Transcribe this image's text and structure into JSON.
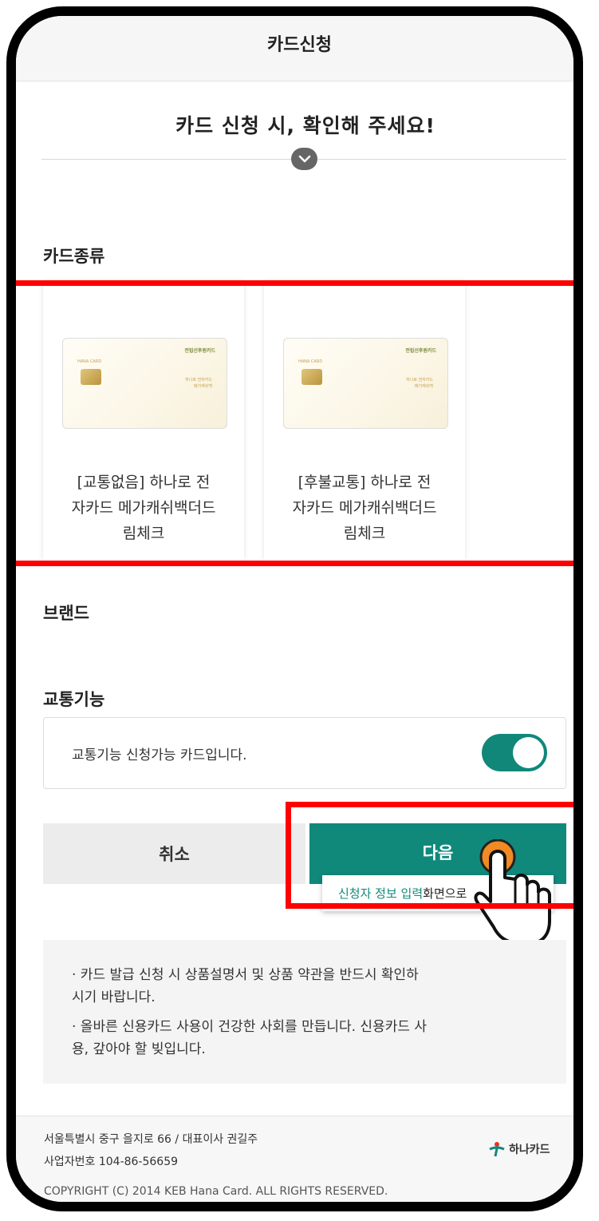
{
  "header": {
    "title": "카드신청"
  },
  "notice": {
    "title": "카드 신청 시, 확인해 주세요!"
  },
  "sections": {
    "card_type": "카드종류",
    "brand": "브랜드",
    "transport": "교통기능"
  },
  "cards": [
    {
      "name": "[교통없음] 하나로 전자카드 메가캐쉬백더드림체크",
      "name_lines": [
        "[교통없음] 하나로 전",
        "자카드 메가캐쉬백더드",
        "림체크"
      ]
    },
    {
      "name": "[후불교통] 하나로 전자카드 메가캐쉬백더드림체크",
      "name_lines": [
        "[후불교통] 하나로 전",
        "자카드 메가캐쉬백더드",
        "림체크"
      ]
    }
  ],
  "card_art": {
    "brand": "HANA CARD",
    "logo": "전립선후원카드",
    "meta_1": "하나로 전자카드",
    "meta_2": "메가캐쉬백"
  },
  "transport": {
    "text": "교통기능 신청가능 카드입니다.",
    "toggle_on": true
  },
  "buttons": {
    "cancel": "취소",
    "next": "다음"
  },
  "tooltip": {
    "highlight": "신청자 정보 입력",
    "rest": " 화면으로"
  },
  "info": {
    "lines": [
      "· 카드 발급 신청 시 상품설명서 및 상품 약관을 반드시 확인하",
      "  시기 바랍니다.",
      "· 올바른 신용카드 사용이 건강한 사회를 만듭니다. 신용카드 사",
      "  용, 갚아야 할 빚입니다."
    ]
  },
  "footer": {
    "address": "서울특별시 중구 을지로 66  /  대표이사 권길주",
    "business_no": "사업자번호 104-86-56659",
    "copyright": "COPYRIGHT (C) 2014 KEB Hana Card. ALL RIGHTS RESERVED.",
    "logo_text": "하나카드"
  },
  "colors": {
    "accent": "#10897b",
    "highlight_box": "#ff0000",
    "pointer": "#f08a24"
  }
}
